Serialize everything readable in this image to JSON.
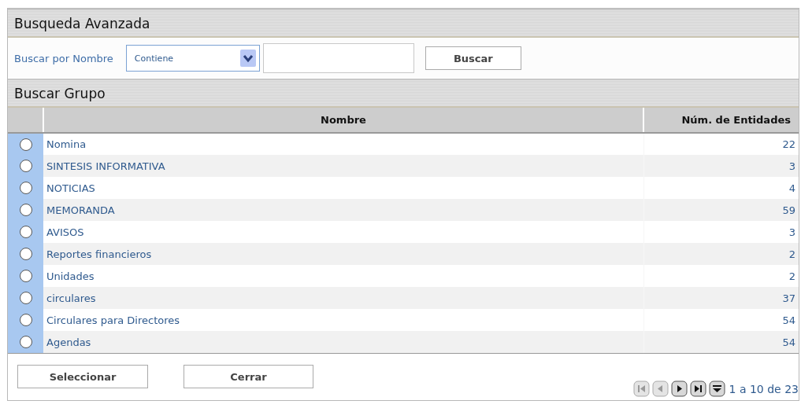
{
  "search_panel": {
    "title": "Busqueda Avanzada",
    "label": "Buscar por Nombre",
    "match_select": {
      "value": "Contiene"
    },
    "search_button": "Buscar"
  },
  "group_panel": {
    "title": "Buscar Grupo",
    "columns": [
      "Nombre",
      "Núm. de Entidades"
    ],
    "rows": [
      {
        "name": "Nomina",
        "count": "22",
        "selected": false
      },
      {
        "name": "SINTESIS INFORMATIVA",
        "count": "3",
        "selected": false
      },
      {
        "name": "NOTICIAS",
        "count": "4",
        "selected": false
      },
      {
        "name": "MEMORANDA",
        "count": "59",
        "selected": false
      },
      {
        "name": "AVISOS",
        "count": "3",
        "selected": false
      },
      {
        "name": "Reportes financieros",
        "count": "2",
        "selected": false
      },
      {
        "name": "Unidades",
        "count": "2",
        "selected": false
      },
      {
        "name": "circulares",
        "count": "37",
        "selected": false
      },
      {
        "name": "Circulares para Directores",
        "count": "54",
        "selected": false
      },
      {
        "name": "Agendas",
        "count": "54",
        "selected": false
      }
    ]
  },
  "footer": {
    "buttons": [
      "Seleccionar",
      "Cerrar"
    ],
    "pager": {
      "controls": [
        {
          "kind": "first",
          "disabled": true
        },
        {
          "kind": "prev",
          "disabled": true
        },
        {
          "kind": "next",
          "disabled": false
        },
        {
          "kind": "last",
          "disabled": false
        },
        {
          "kind": "menu",
          "disabled": false
        }
      ],
      "summary": "1 a 10 de 23"
    }
  }
}
